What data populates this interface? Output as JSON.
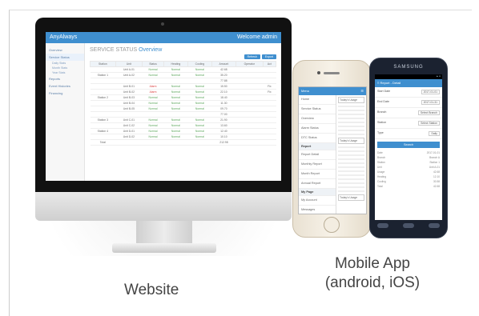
{
  "website": {
    "brand": "AnyAlways",
    "user": "Welcome admin",
    "sidebar": [
      "Overview",
      "Service Status",
      "Daily Stats",
      "Month Stats",
      "Year Stats",
      "Reports",
      "Event Histories",
      "Financing"
    ],
    "page_title": "SERVICE STATUS",
    "page_subtitle": "Overview",
    "buttons": [
      "Refresh",
      "Export"
    ],
    "columns": [
      "Station",
      "Unit",
      "Status",
      "Heating",
      "Cooling",
      "Amount",
      "Operator",
      "Act"
    ],
    "rows": [
      [
        "",
        "Unit A-01",
        "Normal",
        "Normal",
        "Normal",
        "42.68",
        "",
        ""
      ],
      [
        "Station 1",
        "Unit A-02",
        "Normal",
        "Normal",
        "Normal",
        "35.20",
        "",
        ""
      ],
      [
        "",
        "",
        "",
        "",
        "",
        "77.88",
        "",
        ""
      ],
      [
        "",
        "Unit B-01",
        "Alarm",
        "Normal",
        "Normal",
        "15.50",
        "",
        "Fix"
      ],
      [
        "",
        "Unit B-02",
        "Alarm",
        "Normal",
        "Normal",
        "22.10",
        "",
        "Fix"
      ],
      [
        "Station 2",
        "Unit B-03",
        "Normal",
        "Normal",
        "Normal",
        "18.40",
        "",
        ""
      ],
      [
        "",
        "Unit B-04",
        "Normal",
        "Normal",
        "Normal",
        "11.30",
        "",
        ""
      ],
      [
        "",
        "Unit B-05",
        "Normal",
        "Normal",
        "Normal",
        "09.70",
        "",
        ""
      ],
      [
        "",
        "",
        "",
        "",
        "",
        "77.00",
        "",
        ""
      ],
      [
        "Station 3",
        "Unit C-01",
        "Normal",
        "Normal",
        "Normal",
        "21.90",
        "",
        ""
      ],
      [
        "",
        "Unit C-02",
        "Normal",
        "Normal",
        "Normal",
        "13.60",
        "",
        ""
      ],
      [
        "Station 4",
        "Unit D-01",
        "Normal",
        "Normal",
        "Normal",
        "12.40",
        "",
        ""
      ],
      [
        "",
        "Unit D-02",
        "Normal",
        "Normal",
        "Normal",
        "10.10",
        "",
        ""
      ],
      [
        "Total",
        "",
        "",
        "",
        "",
        "212.98",
        "",
        ""
      ]
    ]
  },
  "iphone": {
    "app_title": "Menu",
    "menu": [
      "Home",
      "Service Status",
      "Overview",
      "Alarm Status",
      "DTC Status",
      "Report",
      "Report Detail",
      "Monthly Report",
      "Month Report",
      "Annual Report",
      "My Page",
      "My Account",
      "Messages"
    ],
    "side_buttons": [
      "Today's Usage",
      "Today's Usage",
      "Today's Usage"
    ]
  },
  "android": {
    "brand": "SAMSUNG",
    "screen_title": "Report - Detail",
    "fields": [
      {
        "label": "Start Date",
        "value": "2017-01-01"
      },
      {
        "label": "End Date",
        "value": "2017-01-31"
      },
      {
        "label": "Branch",
        "value": "Select Branch"
      },
      {
        "label": "Station",
        "value": "Select Station"
      },
      {
        "label": "Type",
        "value": "Daily"
      }
    ],
    "search_label": "Search",
    "data_rows": [
      [
        "Date",
        "2017-01-01"
      ],
      [
        "Branch",
        "Branch A"
      ],
      [
        "Station",
        "Station 1"
      ],
      [
        "Unit",
        "Unit A-01"
      ],
      [
        "Usage",
        "42.68"
      ],
      [
        "Heating",
        "12.10"
      ],
      [
        "Cooling",
        "30.58"
      ],
      [
        "Total",
        "42.68"
      ]
    ]
  },
  "captions": {
    "website": "Website",
    "mobile_line1": "Mobile App",
    "mobile_line2": "(android, iOS)"
  }
}
